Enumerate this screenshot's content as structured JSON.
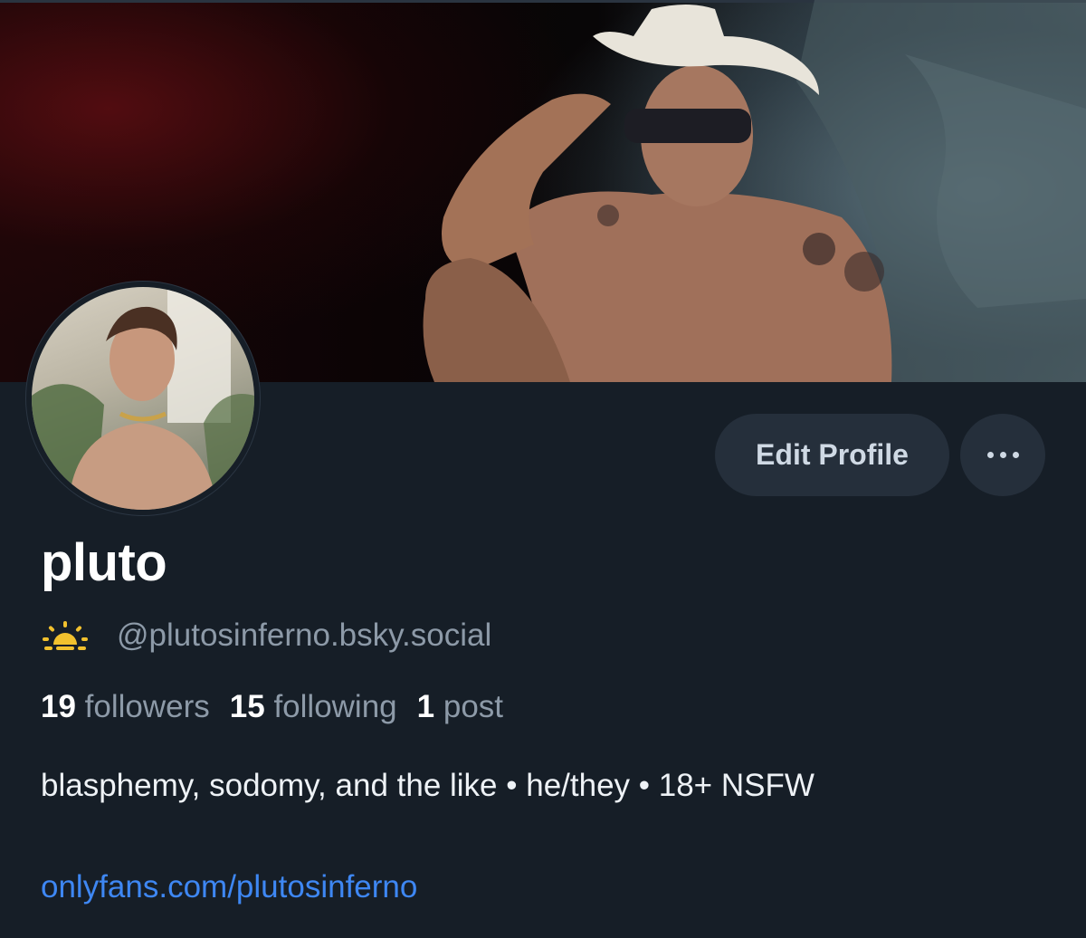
{
  "profile": {
    "display_name": "pluto",
    "handle": "@plutosinferno.bsky.social",
    "handle_icon": "sun-horizon-icon",
    "stats": {
      "followers_count": "19",
      "followers_label": "followers",
      "following_count": "15",
      "following_label": "following",
      "posts_count": "1",
      "posts_label": "post"
    },
    "bio": "blasphemy, sodomy, and the like • he/they • 18+ NSFW",
    "link": "onlyfans.com/plutosinferno"
  },
  "actions": {
    "edit_label": "Edit Profile",
    "more_icon": "ellipsis-icon"
  },
  "colors": {
    "background": "#161e27",
    "button_bg": "#252f3b",
    "muted_text": "#8d9aa8",
    "link": "#3e87f3",
    "icon_yellow": "#f2c12e"
  }
}
